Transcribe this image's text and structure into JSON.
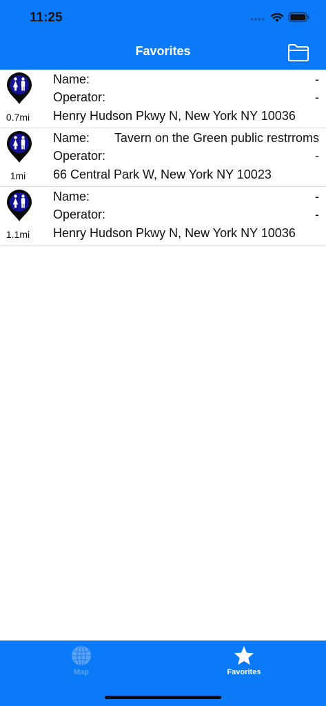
{
  "status_bar": {
    "time": "11:25"
  },
  "nav": {
    "title": "Favorites",
    "folder_icon": "folder-icon"
  },
  "colors": {
    "accent": "#0a7af9",
    "pin": "#0a0a0a",
    "pin_inner": "#131394",
    "tab_inactive": "#5aa3f5"
  },
  "favorites": [
    {
      "name_label": "Name:",
      "name_value": "-",
      "operator_label": "Operator:",
      "operator_value": "-",
      "address": "Henry Hudson Pkwy N, New York NY 10036",
      "distance": "0.7mi"
    },
    {
      "name_label": "Name:",
      "name_value": "Tavern on the Green public restrroms",
      "operator_label": "Operator:",
      "operator_value": "-",
      "address": "66 Central Park W, New York NY 10023",
      "distance": "1mi"
    },
    {
      "name_label": "Name:",
      "name_value": "-",
      "operator_label": "Operator:",
      "operator_value": "-",
      "address": "Henry Hudson Pkwy N, New York NY 10036",
      "distance": "1.1mi"
    }
  ],
  "tabs": [
    {
      "label": "Map",
      "icon": "globe-icon",
      "selected": false
    },
    {
      "label": "Favorites",
      "icon": "star-icon",
      "selected": true
    }
  ]
}
